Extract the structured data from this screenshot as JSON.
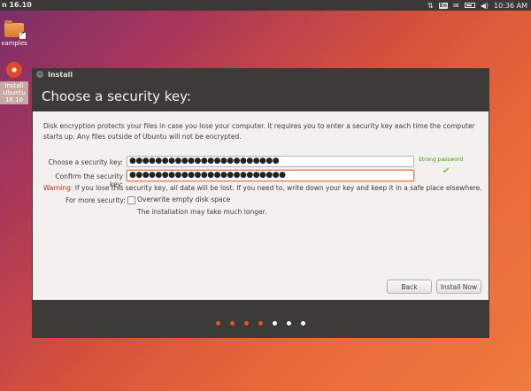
{
  "panel": {
    "title": "n 16.10",
    "clock": "10:36 AM",
    "lang": "En",
    "icons": [
      "network-updown-icon",
      "keyboard-language-icon",
      "mail-icon",
      "battery-icon",
      "volume-icon"
    ]
  },
  "desktop": {
    "examples_label": "xamples",
    "installer_label_1": "Install",
    "installer_label_2": "Ubuntu",
    "installer_label_3": "16.10"
  },
  "window": {
    "title": "Install",
    "header": "Choose a security key:",
    "intro": "Disk encryption protects your files in case you lose your computer. It requires you to enter a security key each time the computer starts up. Any files outside of Ubuntu will not be encrypted.",
    "choose_label": "Choose a security key:",
    "choose_value": "●●●●●●●●●●●●●●●●●●●●●●●",
    "strength": "Strong password",
    "confirm_label": "Confirm the security key:",
    "confirm_value": "●●●●●●●●●●●●●●●●●●●●●●●●",
    "warning_word": "Warning:",
    "warning_text": " If you lose this security key, all data will be lost. If you need to, write down your key and keep it in a safe place elsewhere.",
    "more_security_label": "For more security:",
    "overwrite_label": "Overwrite empty disk space",
    "note": "The installation may take much longer.",
    "back_button": "Back",
    "install_button": "Install Now"
  },
  "colors": {
    "dot_done": "#e95420",
    "dot_todo": "#ffffff"
  },
  "progress": {
    "steps_total": 7,
    "steps_done": 4
  }
}
